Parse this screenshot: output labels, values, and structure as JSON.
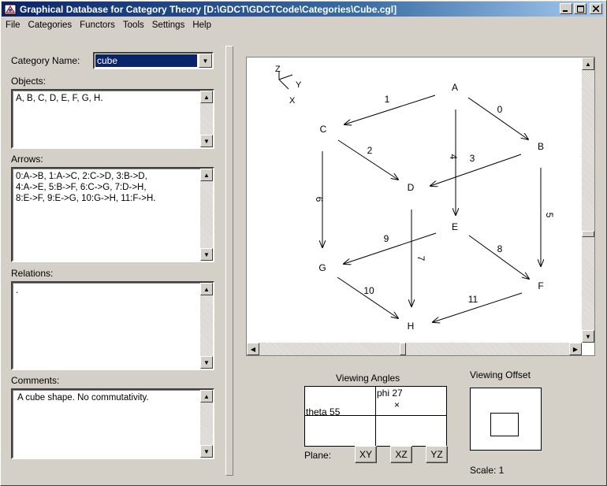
{
  "window": {
    "title": "Graphical Database for Category Theory [D:\\GDCT\\GDCTCode\\Categories\\Cube.cgl]",
    "controls": [
      "_",
      "□",
      "×"
    ]
  },
  "menu": [
    "File",
    "Categories",
    "Functors",
    "Tools",
    "Settings",
    "Help"
  ],
  "left": {
    "category_name_label": "Category Name:",
    "category_name_value": "cube",
    "objects_label": "Objects:",
    "objects_value": "A, B, C, D, E, F, G, H.",
    "arrows_label": "Arrows:",
    "arrows_value": "0:A->B, 1:A->C, 2:C->D, 3:B->D,\n4:A->E, 5:B->F, 6:C->G, 7:D->H,\n8:E->F, 9:E->G, 10:G->H, 11:F->H.",
    "relations_label": "Relations:",
    "relations_value": ".",
    "comments_label": "Comments:",
    "comments_value": "A cube shape. No commutativity."
  },
  "graph": {
    "axes": {
      "z": "Z",
      "y": "Y",
      "x": "X"
    },
    "nodes": [
      {
        "id": "A",
        "label": "A"
      },
      {
        "id": "B",
        "label": "B"
      },
      {
        "id": "C",
        "label": "C"
      },
      {
        "id": "D",
        "label": "D"
      },
      {
        "id": "E",
        "label": "E"
      },
      {
        "id": "F",
        "label": "F"
      },
      {
        "id": "G",
        "label": "G"
      },
      {
        "id": "H",
        "label": "H"
      }
    ],
    "edges": [
      {
        "label": "0",
        "from": "A",
        "to": "B"
      },
      {
        "label": "1",
        "from": "A",
        "to": "C"
      },
      {
        "label": "2",
        "from": "C",
        "to": "D"
      },
      {
        "label": "3",
        "from": "B",
        "to": "D"
      },
      {
        "label": "4",
        "from": "A",
        "to": "E"
      },
      {
        "label": "5",
        "from": "B",
        "to": "F"
      },
      {
        "label": "6",
        "from": "C",
        "to": "G"
      },
      {
        "label": "7",
        "from": "D",
        "to": "H"
      },
      {
        "label": "8",
        "from": "E",
        "to": "F"
      },
      {
        "label": "9",
        "from": "E",
        "to": "G"
      },
      {
        "label": "10",
        "from": "G",
        "to": "H"
      },
      {
        "label": "11",
        "from": "F",
        "to": "H"
      }
    ]
  },
  "viewing_angles": {
    "title": "Viewing Angles",
    "phi_label": "phi 27",
    "theta_label": "theta 55",
    "marker": "×"
  },
  "plane": {
    "label": "Plane:",
    "buttons": [
      "XY",
      "XZ",
      "YZ"
    ]
  },
  "viewing_offset": {
    "title": "Viewing Offset",
    "scale_label": "Scale: 1"
  }
}
